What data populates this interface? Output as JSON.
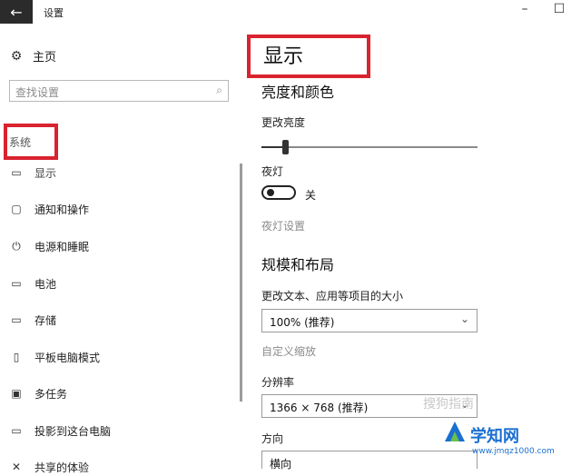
{
  "window": {
    "title": "设置",
    "back": "←",
    "minimize": "–",
    "maximize": "☐"
  },
  "sidebar": {
    "home_label": "主页",
    "search_placeholder": "查找设置",
    "section_label": "系统",
    "items": [
      {
        "label": "显示",
        "icon": "monitor-icon",
        "glyph": "▭"
      },
      {
        "label": "通知和操作",
        "icon": "notification-icon",
        "glyph": "▢"
      },
      {
        "label": "电源和睡眠",
        "icon": "power-icon",
        "glyph": "⏻"
      },
      {
        "label": "电池",
        "icon": "battery-icon",
        "glyph": "▭"
      },
      {
        "label": "存储",
        "icon": "storage-icon",
        "glyph": "▭"
      },
      {
        "label": "平板电脑模式",
        "icon": "tablet-icon",
        "glyph": "▯"
      },
      {
        "label": "多任务",
        "icon": "multitask-icon",
        "glyph": "▣"
      },
      {
        "label": "投影到这台电脑",
        "icon": "project-icon",
        "glyph": "▭"
      },
      {
        "label": "共享的体验",
        "icon": "share-icon",
        "glyph": "✕"
      }
    ]
  },
  "main": {
    "title": "显示",
    "brightness_color_heading": "亮度和颜色",
    "brightness_label": "更改亮度",
    "brightness_value": 0.11,
    "night_light_label": "夜灯",
    "night_light_state": "关",
    "night_light_settings_link": "夜灯设置",
    "scale_layout_heading": "规模和布局",
    "scale_label": "更改文本、应用等项目的大小",
    "scale_value": "100% (推荐)",
    "custom_scaling_link": "自定义缩放",
    "resolution_label": "分辨率",
    "resolution_value": "1366 × 768 (推荐)",
    "orientation_label": "方向",
    "orientation_value": "横向"
  },
  "watermark": {
    "text1": "学知网",
    "text2": "www.jmqz1000.com",
    "text3": "搜狗指南"
  },
  "colors": {
    "highlight_box": "#d9232f",
    "accent_blue": "#1a6fd1"
  }
}
